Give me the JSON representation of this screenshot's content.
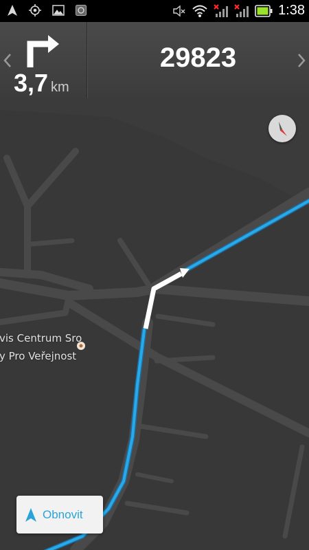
{
  "status_bar": {
    "time": "1:38",
    "icons_left": [
      "navigation-arrow-icon",
      "gps-icon",
      "image-icon",
      "app-icon"
    ],
    "icons_right": [
      "mute-icon",
      "wifi-icon",
      "signal-no-service-icon",
      "signal-no-service-icon",
      "battery-charging-icon"
    ],
    "battery_color": "#9be22d"
  },
  "navigation": {
    "maneuver_icon": "turn-right-icon",
    "distance_value": "3,7",
    "distance_unit": "km",
    "road_name": "29823",
    "prev_icon": "chevron-left-icon",
    "next_icon": "chevron-right-icon"
  },
  "map": {
    "poi_line1": "vis Centrum Sro",
    "poi_line2": "y Pro Veřejnost",
    "route_color": "#29a9e8",
    "compass_icon": "compass-icon"
  },
  "recenter_button": {
    "label": "Obnovit",
    "icon": "navigation-arrow-icon"
  }
}
